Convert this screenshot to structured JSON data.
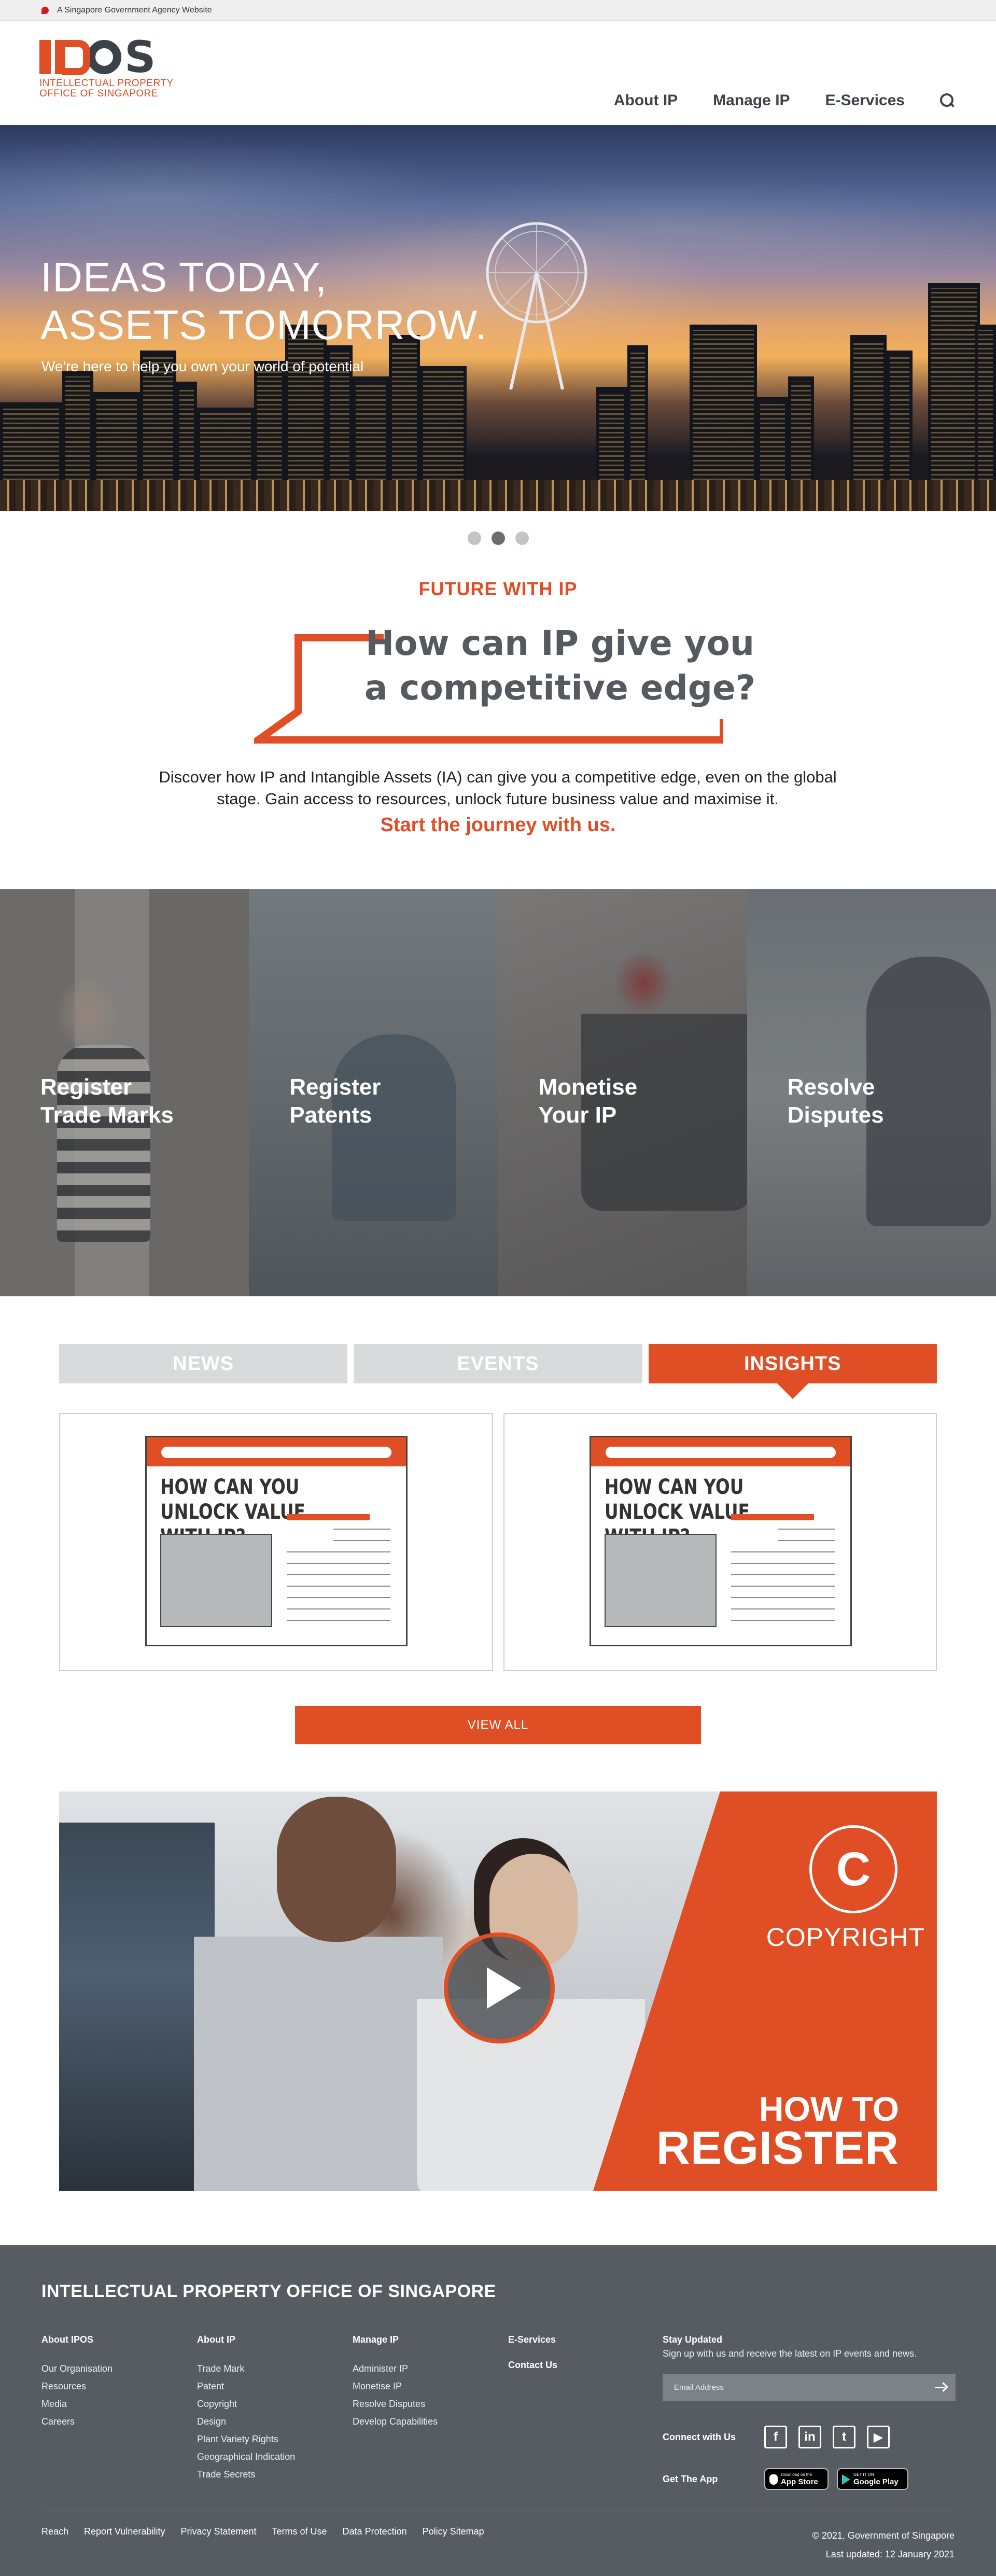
{
  "gov_bar": {
    "text": "A Singapore Government Agency Website"
  },
  "logo": {
    "line1": "INTELLECTUAL PROPERTY",
    "line2": "OFFICE OF SINGAPORE"
  },
  "nav": {
    "items": [
      "About IP",
      "Manage IP",
      "E-Services"
    ]
  },
  "hero": {
    "title_line1": "IDEAS TODAY,",
    "title_line2": "ASSETS TOMORROW.",
    "subtitle": "We're here to help you own your world of potential",
    "slides": 3,
    "active_slide": 2
  },
  "future": {
    "eyebrow": "FUTURE WITH IP",
    "headline_line1": "How can IP give you",
    "headline_line2": "a competitive edge?",
    "description": "Discover how IP and Intangible Assets (IA) can give you a competitive edge, even on the global stage. Gain access to resources, unlock future business value and maximise it.",
    "cta": "Start the journey with us."
  },
  "tiles": [
    {
      "label": "Register\nTrade Marks"
    },
    {
      "label": "Register\nPatents"
    },
    {
      "label": "Monetise\nYour IP"
    },
    {
      "label": "Resolve\nDisputes"
    }
  ],
  "tabs": {
    "items": [
      "NEWS",
      "EVENTS",
      "INSIGHTS"
    ],
    "active": "INSIGHTS"
  },
  "insight_cards": [
    {
      "headline": "HOW CAN YOU UNLOCK VALUE WITH IP?"
    },
    {
      "headline": "HOW CAN YOU UNLOCK VALUE WITH IP?"
    }
  ],
  "view_all": "VIEW ALL",
  "banner": {
    "symbol": "C",
    "label": "COPYRIGHT",
    "how_to": "HOW TO",
    "register": "REGISTER"
  },
  "footer": {
    "title": "INTELLECTUAL PROPERTY OFFICE OF SINGAPORE",
    "columns": [
      {
        "heading": "About IPOS",
        "links": [
          "Our Organisation",
          "Resources",
          "Media",
          "Careers"
        ]
      },
      {
        "heading": "About IP",
        "links": [
          "Trade Mark",
          "Patent",
          "Copyright",
          "Design",
          "Plant Variety Rights",
          "Geographical Indication",
          "Trade Secrets"
        ]
      },
      {
        "heading": "Manage IP",
        "links": [
          "Administer IP",
          "Monetise IP",
          "Resolve Disputes",
          "Develop Capabilities"
        ]
      },
      {
        "heading": "E-Services",
        "links": []
      }
    ],
    "contact_us": "Contact Us",
    "stay_updated": {
      "heading": "Stay Updated",
      "text": "Sign up with us and receive the latest on IP events and news.",
      "email_placeholder": "Email Address"
    },
    "connect_label": "Connect with Us",
    "social": [
      {
        "icon": "facebook-icon",
        "glyph": "f"
      },
      {
        "icon": "linkedin-icon",
        "glyph": "in"
      },
      {
        "icon": "twitter-icon",
        "glyph": "t"
      },
      {
        "icon": "youtube-icon",
        "glyph": "▶"
      }
    ],
    "app_label": "Get The App",
    "app_store": {
      "small": "Download on the",
      "big": "App Store"
    },
    "google_play": {
      "small": "GET IT ON",
      "big": "Google Play"
    },
    "legal_links": [
      "Reach",
      "Report Vulnerability",
      "Privacy Statement",
      "Terms of Use",
      "Data Protection",
      "Policy Sitemap"
    ],
    "copyright": "© 2021, Government of Singapore",
    "last_updated": "Last updated: 12 January 2021"
  },
  "colors": {
    "accent": "#e04e26",
    "dark": "#3d4148",
    "footer": "#575c62"
  }
}
